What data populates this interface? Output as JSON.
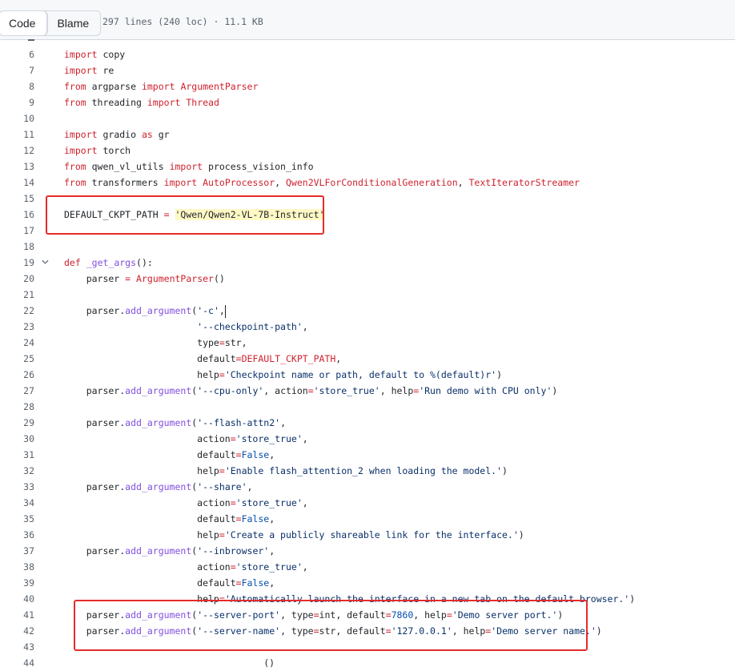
{
  "toolbar": {
    "code_tab": "Code",
    "blame_tab": "Blame",
    "file_info": "297 lines (240 loc) · 11.1 KB"
  },
  "colors": {
    "keyword": "#cf222e",
    "string": "#0a3069",
    "function": "#8250df",
    "constant": "#0550ae",
    "annotation_box": "#e52b2b"
  },
  "icons": {
    "fold": "chevron-down-icon"
  },
  "lines": [
    {
      "n": "6",
      "t": [
        [
          "k",
          "import"
        ],
        [
          "",
          " copy"
        ]
      ]
    },
    {
      "n": "7",
      "t": [
        [
          "k",
          "import"
        ],
        [
          "",
          " re"
        ]
      ]
    },
    {
      "n": "8",
      "t": [
        [
          "k",
          "from"
        ],
        [
          "",
          " argparse "
        ],
        [
          "k",
          "import"
        ],
        [
          "",
          " "
        ],
        [
          "k",
          "ArgumentParser"
        ]
      ]
    },
    {
      "n": "9",
      "t": [
        [
          "k",
          "from"
        ],
        [
          "",
          " threading "
        ],
        [
          "k",
          "import"
        ],
        [
          "",
          " "
        ],
        [
          "k",
          "Thread"
        ]
      ]
    },
    {
      "n": "10",
      "t": []
    },
    {
      "n": "11",
      "t": [
        [
          "k",
          "import"
        ],
        [
          "",
          " gradio "
        ],
        [
          "k",
          "as"
        ],
        [
          "",
          " gr"
        ]
      ]
    },
    {
      "n": "12",
      "t": [
        [
          "k",
          "import"
        ],
        [
          "",
          " torch"
        ]
      ]
    },
    {
      "n": "13",
      "t": [
        [
          "k",
          "from"
        ],
        [
          "",
          " qwen_vl_utils "
        ],
        [
          "k",
          "import"
        ],
        [
          "",
          " process_vision_info"
        ]
      ]
    },
    {
      "n": "14",
      "t": [
        [
          "k",
          "from"
        ],
        [
          "",
          " transformers "
        ],
        [
          "k",
          "import"
        ],
        [
          "",
          " "
        ],
        [
          "k",
          "AutoProcessor"
        ],
        [
          "",
          ", "
        ],
        [
          "k",
          "Qwen2VLForConditionalGeneration"
        ],
        [
          "",
          ", "
        ],
        [
          "k",
          "TextIteratorStreamer"
        ]
      ]
    },
    {
      "n": "15",
      "t": []
    },
    {
      "n": "16",
      "t": [
        [
          "",
          "DEFAULT_CKPT_PATH "
        ],
        [
          "k",
          "="
        ],
        [
          "",
          " "
        ],
        [
          "hl",
          "'Qwen/Qwen2-VL-7B-Instruct'"
        ]
      ]
    },
    {
      "n": "17",
      "t": []
    },
    {
      "n": "18",
      "t": []
    },
    {
      "n": "19",
      "fold": true,
      "t": [
        [
          "k",
          "def"
        ],
        [
          "",
          " "
        ],
        [
          "f",
          "_get_args"
        ],
        [
          "",
          "():"
        ]
      ]
    },
    {
      "n": "20",
      "t": [
        [
          "",
          "    parser "
        ],
        [
          "k",
          "="
        ],
        [
          "",
          " "
        ],
        [
          "k",
          "ArgumentParser"
        ],
        [
          "",
          "()"
        ]
      ]
    },
    {
      "n": "21",
      "t": []
    },
    {
      "n": "22",
      "cursor": true,
      "t": [
        [
          "",
          "    parser."
        ],
        [
          "f",
          "add_argument"
        ],
        [
          "",
          "("
        ],
        [
          "s",
          "'-c'"
        ],
        [
          "",
          ","
        ]
      ]
    },
    {
      "n": "23",
      "t": [
        [
          "",
          "                        "
        ],
        [
          "s",
          "'--checkpoint-path'"
        ],
        [
          "",
          ","
        ]
      ]
    },
    {
      "n": "24",
      "t": [
        [
          "",
          "                        type"
        ],
        [
          "k",
          "="
        ],
        [
          "",
          "str,"
        ]
      ]
    },
    {
      "n": "25",
      "t": [
        [
          "",
          "                        default"
        ],
        [
          "k",
          "="
        ],
        [
          "k",
          "DEFAULT_CKPT_PATH"
        ],
        [
          "",
          ","
        ]
      ]
    },
    {
      "n": "26",
      "t": [
        [
          "",
          "                        help"
        ],
        [
          "k",
          "="
        ],
        [
          "s",
          "'Checkpoint name or path, default to %(default)r'"
        ],
        [
          "",
          ")"
        ]
      ]
    },
    {
      "n": "27",
      "t": [
        [
          "",
          "    parser."
        ],
        [
          "f",
          "add_argument"
        ],
        [
          "",
          "("
        ],
        [
          "s",
          "'--cpu-only'"
        ],
        [
          "",
          ", action"
        ],
        [
          "k",
          "="
        ],
        [
          "s",
          "'store_true'"
        ],
        [
          "",
          ", help"
        ],
        [
          "k",
          "="
        ],
        [
          "s",
          "'Run demo with CPU only'"
        ],
        [
          "",
          ")"
        ]
      ]
    },
    {
      "n": "28",
      "t": []
    },
    {
      "n": "29",
      "t": [
        [
          "",
          "    parser."
        ],
        [
          "f",
          "add_argument"
        ],
        [
          "",
          "("
        ],
        [
          "s",
          "'--flash-attn2'"
        ],
        [
          "",
          ","
        ]
      ]
    },
    {
      "n": "30",
      "t": [
        [
          "",
          "                        action"
        ],
        [
          "k",
          "="
        ],
        [
          "s",
          "'store_true'"
        ],
        [
          "",
          ","
        ]
      ]
    },
    {
      "n": "31",
      "t": [
        [
          "",
          "                        default"
        ],
        [
          "k",
          "="
        ],
        [
          "c",
          "False"
        ],
        [
          "",
          ","
        ]
      ]
    },
    {
      "n": "32",
      "t": [
        [
          "",
          "                        help"
        ],
        [
          "k",
          "="
        ],
        [
          "s",
          "'Enable flash_attention_2 when loading the model.'"
        ],
        [
          "",
          ")"
        ]
      ]
    },
    {
      "n": "33",
      "t": [
        [
          "",
          "    parser."
        ],
        [
          "f",
          "add_argument"
        ],
        [
          "",
          "("
        ],
        [
          "s",
          "'--share'"
        ],
        [
          "",
          ","
        ]
      ]
    },
    {
      "n": "34",
      "t": [
        [
          "",
          "                        action"
        ],
        [
          "k",
          "="
        ],
        [
          "s",
          "'store_true'"
        ],
        [
          "",
          ","
        ]
      ]
    },
    {
      "n": "35",
      "t": [
        [
          "",
          "                        default"
        ],
        [
          "k",
          "="
        ],
        [
          "c",
          "False"
        ],
        [
          "",
          ","
        ]
      ]
    },
    {
      "n": "36",
      "t": [
        [
          "",
          "                        help"
        ],
        [
          "k",
          "="
        ],
        [
          "s",
          "'Create a publicly shareable link for the interface.'"
        ],
        [
          "",
          ")"
        ]
      ]
    },
    {
      "n": "37",
      "t": [
        [
          "",
          "    parser."
        ],
        [
          "f",
          "add_argument"
        ],
        [
          "",
          "("
        ],
        [
          "s",
          "'--inbrowser'"
        ],
        [
          "",
          ","
        ]
      ]
    },
    {
      "n": "38",
      "t": [
        [
          "",
          "                        action"
        ],
        [
          "k",
          "="
        ],
        [
          "s",
          "'store_true'"
        ],
        [
          "",
          ","
        ]
      ]
    },
    {
      "n": "39",
      "t": [
        [
          "",
          "                        default"
        ],
        [
          "k",
          "="
        ],
        [
          "c",
          "False"
        ],
        [
          "",
          ","
        ]
      ]
    },
    {
      "n": "40",
      "t": [
        [
          "",
          "                        help"
        ],
        [
          "k",
          "="
        ],
        [
          "s",
          "'Automatically launch the interface in a new tab on the default browser.'"
        ],
        [
          "",
          ")"
        ]
      ]
    },
    {
      "n": "41",
      "t": [
        [
          "",
          "    parser."
        ],
        [
          "f",
          "add_argument"
        ],
        [
          "",
          "("
        ],
        [
          "s",
          "'--server-port'"
        ],
        [
          "",
          ", type"
        ],
        [
          "k",
          "="
        ],
        [
          "",
          "int, default"
        ],
        [
          "k",
          "="
        ],
        [
          "c",
          "7860"
        ],
        [
          "",
          ", help"
        ],
        [
          "k",
          "="
        ],
        [
          "s",
          "'Demo server port.'"
        ],
        [
          "",
          ")"
        ]
      ]
    },
    {
      "n": "42",
      "t": [
        [
          "",
          "    parser."
        ],
        [
          "f",
          "add_argument"
        ],
        [
          "",
          "("
        ],
        [
          "s",
          "'--server-name'"
        ],
        [
          "",
          ", type"
        ],
        [
          "k",
          "="
        ],
        [
          "",
          "str, default"
        ],
        [
          "k",
          "="
        ],
        [
          "s",
          "'127.0.0.1'"
        ],
        [
          "",
          ", help"
        ],
        [
          "k",
          "="
        ],
        [
          "s",
          "'Demo server name.'"
        ],
        [
          "",
          ")"
        ]
      ]
    },
    {
      "n": "43",
      "t": []
    },
    {
      "n": "44",
      "t": [
        [
          "",
          "                                    ()"
        ]
      ]
    }
  ]
}
